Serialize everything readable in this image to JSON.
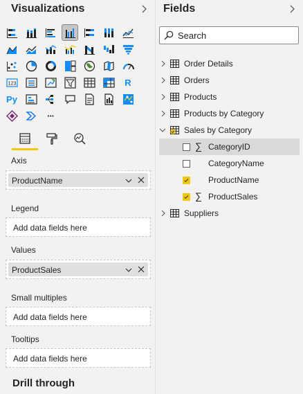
{
  "visualizations": {
    "title": "Visualizations",
    "collapse_icon": "chevron-right-icon",
    "selected_visual": "clustered-column-chart",
    "visual_icons": [
      "stacked-bar-chart",
      "stacked-column-chart",
      "clustered-bar-chart",
      "clustered-column-chart",
      "100-stacked-bar-chart",
      "100-stacked-column-chart",
      "line-chart",
      "area-chart",
      "stacked-area-chart",
      "line-and-stacked-column-chart",
      "line-and-clustered-column-chart",
      "ribbon-chart",
      "waterfall-chart",
      "funnel-chart",
      "scatter-chart",
      "pie-chart",
      "donut-chart",
      "treemap",
      "map",
      "filled-map",
      "gauge",
      "card",
      "multi-row-card",
      "kpi",
      "slicer",
      "table",
      "matrix",
      "r-script-visual",
      "python-visual",
      "key-influencers",
      "decomposition-tree",
      "qa",
      "smart-narrative",
      "paginated-report",
      "arcgis-map",
      "power-apps",
      "power-automate",
      "more-visuals"
    ],
    "r_glyph": "R",
    "python_glyph": "Py",
    "more_glyph": "···",
    "tabs": [
      "fields-tab",
      "format-tab",
      "analytics-tab"
    ],
    "wells": {
      "axis": {
        "label": "Axis",
        "field": "ProductName"
      },
      "legend": {
        "label": "Legend",
        "placeholder": "Add data fields here"
      },
      "values": {
        "label": "Values",
        "field": "ProductSales"
      },
      "small_multiples": {
        "label": "Small multiples",
        "placeholder": "Add data fields here"
      },
      "tooltips": {
        "label": "Tooltips",
        "placeholder": "Add data fields here"
      }
    },
    "drill_through": "Drill through"
  },
  "fields": {
    "title": "Fields",
    "collapse_icon": "chevron-right-icon",
    "search": {
      "placeholder": "Search",
      "value": ""
    },
    "tables_before": [
      "Order Details",
      "Orders",
      "Products",
      "Products by Category"
    ],
    "expanded_table": {
      "name": "Sales by Category",
      "fields": [
        {
          "name": "CategoryID",
          "checked": false,
          "sigma": true
        },
        {
          "name": "CategoryName",
          "checked": false,
          "sigma": false
        },
        {
          "name": "ProductName",
          "checked": true,
          "sigma": false
        },
        {
          "name": "ProductSales",
          "checked": true,
          "sigma": true
        }
      ]
    },
    "tables_after": [
      "Suppliers"
    ],
    "sigma_glyph": "∑"
  },
  "colors": {
    "accent_yellow": "#f2c80f",
    "power_bi_blue": "#118dff",
    "pane_bg": "#f3f2f1"
  }
}
